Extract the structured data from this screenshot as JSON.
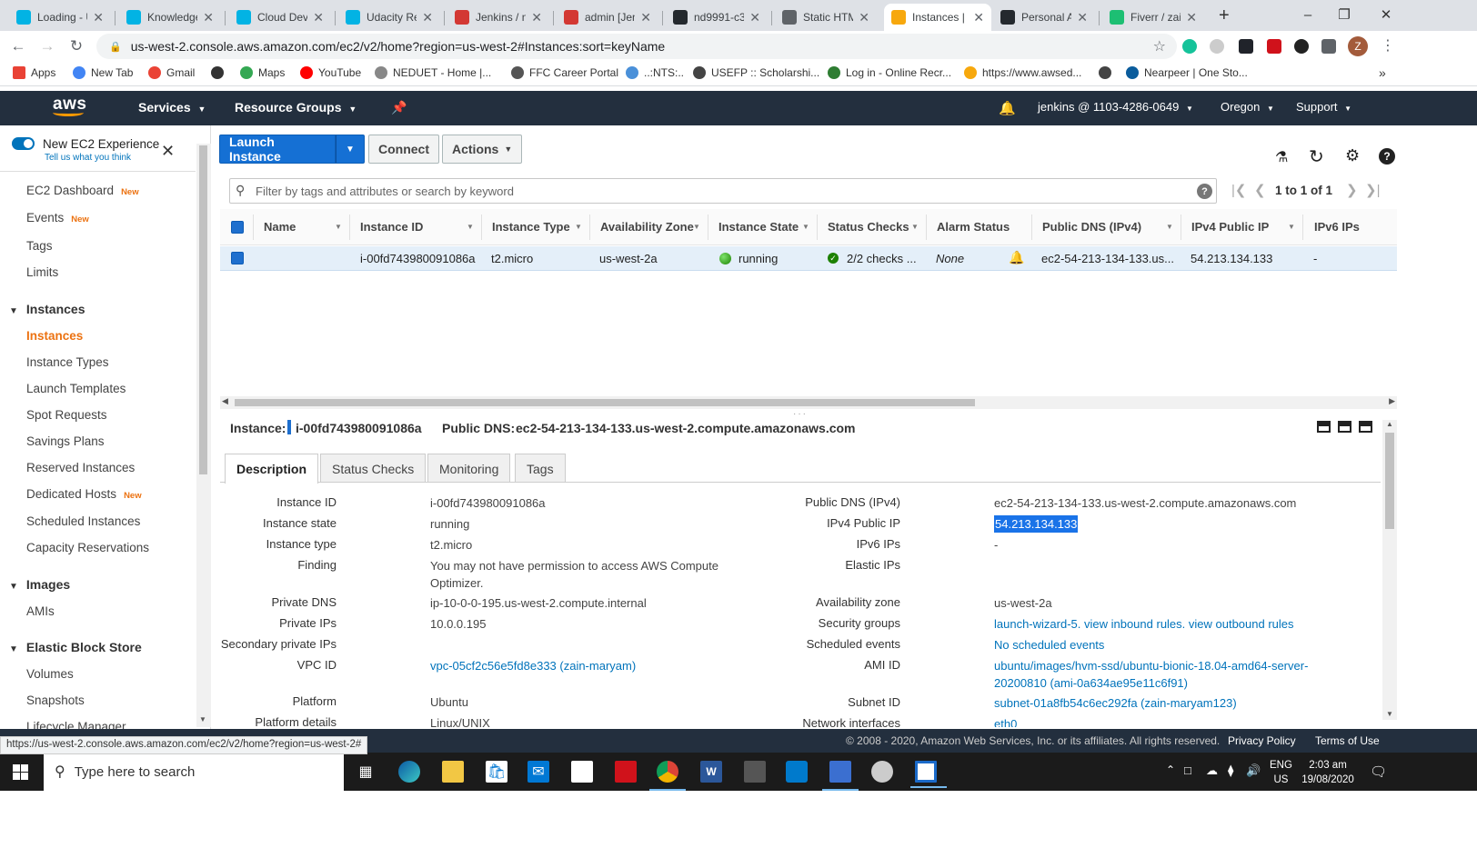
{
  "browser": {
    "tabs": [
      {
        "label": "Loading - U",
        "icon": "udacity-icon",
        "color": "#02b3e4"
      },
      {
        "label": "Knowledge",
        "icon": "udacity-icon",
        "color": "#02b3e4"
      },
      {
        "label": "Cloud DevO",
        "icon": "udacity-icon",
        "color": "#02b3e4"
      },
      {
        "label": "Udacity Rev",
        "icon": "udacity-icon",
        "color": "#02b3e4"
      },
      {
        "label": "Jenkins / nd",
        "icon": "jenkins-icon",
        "color": "#d33833"
      },
      {
        "label": "admin [Jen",
        "icon": "jenkins-icon",
        "color": "#d33833"
      },
      {
        "label": "nd9991-c3",
        "icon": "github-icon",
        "color": "#24292e"
      },
      {
        "label": "Static HTM",
        "icon": "globe-icon",
        "color": "#5f6368"
      },
      {
        "label": "Instances |",
        "icon": "aws-icon",
        "color": "#f7a80d"
      },
      {
        "label": "Personal Ac",
        "icon": "github-icon",
        "color": "#24292e"
      },
      {
        "label": "Fiverr / zain",
        "icon": "fiverr-icon",
        "color": "#1dbf73"
      }
    ],
    "url": "us-west-2.console.aws.amazon.com/ec2/v2/home?region=us-west-2#Instances:sort=keyName",
    "profile_initial": "Z",
    "bookmarks": [
      {
        "label": "Apps"
      },
      {
        "label": "New Tab"
      },
      {
        "label": "Gmail"
      },
      {
        "label": ""
      },
      {
        "label": "Maps"
      },
      {
        "label": "YouTube"
      },
      {
        "label": "NEDUET - Home |..."
      },
      {
        "label": "FFC Career Portal"
      },
      {
        "label": "..:NTS:.."
      },
      {
        "label": "USEFP :: Scholarshi..."
      },
      {
        "label": "Log in - Online Recr..."
      },
      {
        "label": "https://www.awsed..."
      },
      {
        "label": ""
      },
      {
        "label": "Nearpeer | One Sto..."
      }
    ],
    "bookmarks_more": "»",
    "status_url": "https://us-west-2.console.aws.amazon.com/ec2/v2/home?region=us-west-2#"
  },
  "aws_nav": {
    "logo": "aws",
    "services": "Services",
    "resource_groups": "Resource Groups",
    "account": "jenkins @ 1103-4286-0649",
    "region": "Oregon",
    "support": "Support"
  },
  "sidebar": {
    "new_experience": "New EC2 Experience",
    "feedback": "Tell us what you think",
    "new_badge": "New",
    "top_items": [
      {
        "label": "EC2 Dashboard",
        "badge": "New"
      },
      {
        "label": "Events",
        "badge": "New"
      },
      {
        "label": "Tags",
        "badge": ""
      },
      {
        "label": "Limits",
        "badge": ""
      }
    ],
    "instances_header": "Instances",
    "instances_items": [
      {
        "label": "Instances",
        "badge": ""
      },
      {
        "label": "Instance Types",
        "badge": ""
      },
      {
        "label": "Launch Templates",
        "badge": ""
      },
      {
        "label": "Spot Requests",
        "badge": ""
      },
      {
        "label": "Savings Plans",
        "badge": ""
      },
      {
        "label": "Reserved Instances",
        "badge": ""
      },
      {
        "label": "Dedicated Hosts",
        "badge": "New"
      },
      {
        "label": "Scheduled Instances",
        "badge": ""
      },
      {
        "label": "Capacity Reservations",
        "badge": ""
      }
    ],
    "images_header": "Images",
    "images_items": [
      {
        "label": "AMIs"
      }
    ],
    "ebs_header": "Elastic Block Store",
    "ebs_items": [
      {
        "label": "Volumes"
      },
      {
        "label": "Snapshots"
      },
      {
        "label": "Lifecycle Manager"
      }
    ]
  },
  "toolbar": {
    "launch": "Launch Instance",
    "connect": "Connect",
    "actions": "Actions"
  },
  "filter": {
    "placeholder": "Filter by tags and attributes or search by keyword",
    "pagination": "1 to 1 of 1"
  },
  "table": {
    "columns": [
      "Name",
      "Instance ID",
      "Instance Type",
      "Availability Zone",
      "Instance State",
      "Status Checks",
      "Alarm Status",
      "Public DNS (IPv4)",
      "IPv4 Public IP",
      "IPv6 IPs"
    ],
    "row": {
      "name": "",
      "instance_id": "i-00fd743980091086a",
      "instance_type": "t2.micro",
      "zone": "us-west-2a",
      "state": "running",
      "checks": "2/2 checks ...",
      "alarm": "None",
      "dns": "ec2-54-213-134-133.us...",
      "ipv4": "54.213.134.133",
      "ipv6": "-"
    },
    "colors": {
      "running": "#1d8102",
      "selected": "#e4eff9"
    }
  },
  "detail": {
    "instance_label": "Instance:",
    "instance_id": "i-00fd743980091086a",
    "public_dns_label": "Public DNS:",
    "public_dns": "ec2-54-213-134-133.us-west-2.compute.amazonaws.com",
    "tabs": [
      "Description",
      "Status Checks",
      "Monitoring",
      "Tags"
    ],
    "left": [
      {
        "label": "Instance ID",
        "value": "i-00fd743980091086a",
        "link": false
      },
      {
        "label": "Instance state",
        "value": "running",
        "link": false
      },
      {
        "label": "Instance type",
        "value": "t2.micro",
        "link": false
      },
      {
        "label": "Finding",
        "value": "You may not have permission to access AWS Compute",
        "value2": "Optimizer.",
        "link": false
      },
      {
        "label": "Private DNS",
        "value": "ip-10-0-0-195.us-west-2.compute.internal",
        "link": false
      },
      {
        "label": "Private IPs",
        "value": "10.0.0.195",
        "link": false
      },
      {
        "label": "Secondary private IPs",
        "value": "",
        "link": false
      },
      {
        "label": "VPC ID",
        "value": "vpc-05cf2c56e5fd8e333 (zain-maryam)",
        "link": true
      },
      {
        "label": "Platform",
        "value": "Ubuntu",
        "link": false
      },
      {
        "label": "Platform details",
        "value": "Linux/UNIX",
        "link": false
      }
    ],
    "right": [
      {
        "label": "Public DNS (IPv4)",
        "value": "ec2-54-213-134-133.us-west-2.compute.amazonaws.com",
        "link": false
      },
      {
        "label": "IPv4 Public IP",
        "value": "54.213.134.133",
        "link": false,
        "selected": true
      },
      {
        "label": "IPv6 IPs",
        "value": "-",
        "link": false
      },
      {
        "label": "Elastic IPs",
        "value": "",
        "link": false
      },
      {
        "label": "Availability zone",
        "value": "us-west-2a",
        "link": false
      },
      {
        "label": "Security groups",
        "value": "launch-wizard-5. view inbound rules. view outbound rules",
        "link": true
      },
      {
        "label": "Scheduled events",
        "value": "No scheduled events",
        "link": true
      },
      {
        "label": "AMI ID",
        "value": "ubuntu/images/hvm-ssd/ubuntu-bionic-18.04-amd64-server-",
        "value2": "20200810 (ami-0a634ae95e11c6f91)",
        "link": true
      },
      {
        "label": "Subnet ID",
        "value": "subnet-01a8fb54c6ec292fa (zain-maryam123)",
        "link": true
      },
      {
        "label": "Network interfaces",
        "value": "eth0",
        "link": true
      }
    ]
  },
  "footer": {
    "copyright": "© 2008 - 2020, Amazon Web Services, Inc. or its affiliates. All rights reserved.",
    "privacy": "Privacy Policy",
    "terms": "Terms of Use"
  },
  "taskbar": {
    "search": "Type here to search",
    "lang1": "ENG",
    "lang2": "US",
    "time": "2:03 am",
    "date": "19/08/2020"
  }
}
